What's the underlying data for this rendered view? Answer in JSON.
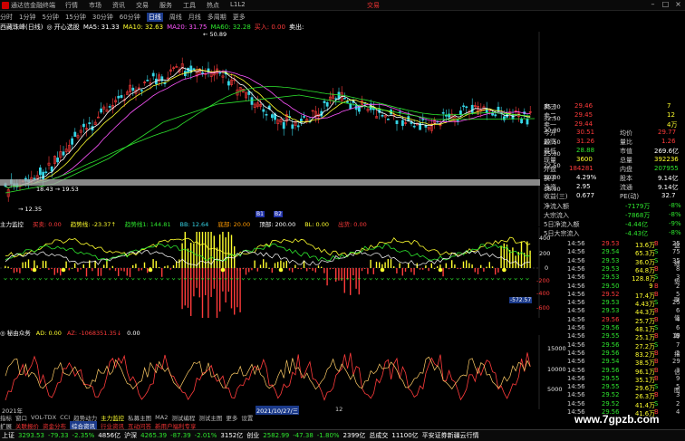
{
  "app_title": "通达信金融终端",
  "menu": [
    "行情",
    "市场",
    "资讯",
    "交易",
    "服务",
    "工具",
    "热点",
    "L1L2"
  ],
  "deal_label": "交易",
  "window_controls": [
    "–",
    "□",
    "×"
  ],
  "toolbar": [
    "分时",
    "1分钟",
    "5分钟",
    "15分钟",
    "30分钟",
    "60分钟",
    "日线",
    "周线",
    "月线",
    "多周期",
    "更多"
  ],
  "toolbar_active": 6,
  "chart_title": [
    {
      "text": "西藏珠峰(日线)",
      "color": "#ffffff"
    },
    {
      "text": "◎ 开心选股",
      "color": "#ffffff"
    },
    {
      "text": "MA5: 31.33",
      "color": "#ffffff"
    },
    {
      "text": "MA10: 32.63",
      "color": "#ffff2e"
    },
    {
      "text": "MA20: 31.75",
      "color": "#ff55ff"
    },
    {
      "text": "MA60: 32.28",
      "color": "#2ee62e"
    },
    {
      "text": "买入: 0.00",
      "color": "#ff3b3b"
    },
    {
      "text": "卖出:",
      "color": "#ffffff"
    }
  ],
  "price_axis": [
    "35.00",
    "32.50",
    "30.00",
    "27.50",
    "25.00",
    "22.50",
    "20.00",
    "18.00"
  ],
  "price_labels": {
    "high": "← 50.89",
    "low": "18.43 → 19.53",
    "low2": "→ 12.35"
  },
  "main_indicator_title": [
    {
      "text": "主力监控",
      "color": "#ffffff"
    },
    {
      "text": "买卖: 0.00",
      "color": "#ff3b3b"
    },
    {
      "text": "趋势线: -23.37↑",
      "color": "#ffff2e"
    },
    {
      "text": "趋势线1: 144.81",
      "color": "#2ee62e"
    },
    {
      "text": "BB: 12.64",
      "color": "#36d6e7"
    },
    {
      "text": "底部: 20.00",
      "color": "#ff9a00"
    },
    {
      "text": "顶部: 200.00",
      "color": "#ffffff"
    },
    {
      "text": "BL: 0.00",
      "color": "#ffff2e"
    },
    {
      "text": "出货: 0.00",
      "color": "#ff3b3b"
    }
  ],
  "ind_axis": [
    "400",
    "200",
    "0",
    "-200",
    "-400",
    "-600"
  ],
  "ind_marker": "-572.57",
  "ind_badges": [
    "B1",
    "B2"
  ],
  "ad_title": [
    {
      "text": "◎ 秘由众务",
      "color": "#ffffff"
    },
    {
      "text": "AD: 0.00",
      "color": "#ffff2e"
    },
    {
      "text": "AZ: -1068351.35↓",
      "color": "#ff3b3b"
    },
    {
      "text": "0.00",
      "color": "#ffffff"
    }
  ],
  "ad_axis": [
    "15000",
    "10000",
    "5000"
  ],
  "date_axis": {
    "year": "2021年",
    "highlight": "2021/10/27/三",
    "month": "12"
  },
  "right_panel": {
    "orderbook": [
      {
        "label": "卖三",
        "price": "29.46",
        "vol": "7"
      },
      {
        "label": "卖二",
        "price": "29.45",
        "vol": "12"
      },
      {
        "label": "卖一",
        "price": "29.44",
        "vol": "4万"
      }
    ],
    "stats": [
      {
        "l1": "今开",
        "v1": "30.51",
        "c1": "#ff3b3b",
        "l2": "均价",
        "v2": "29.77",
        "c2": "#ff3b3b"
      },
      {
        "l1": "最高",
        "v1": "31.26",
        "c1": "#ff3b3b",
        "l2": "量比",
        "v2": "1.26",
        "c2": "#ff3b3b"
      },
      {
        "l1": "最低",
        "v1": "28.88",
        "c1": "#2ee62e",
        "l2": "市值",
        "v2": "269.6亿",
        "c2": "#ffffff"
      },
      {
        "l1": "现量",
        "v1": "3600",
        "c1": "#ffff2e",
        "l2": "总量",
        "v2": "392236",
        "c2": "#ffff2e"
      },
      {
        "l1": "外盘",
        "v1": "184281",
        "c1": "#ff3b3b",
        "l2": "内盘",
        "v2": "207955",
        "c2": "#2ee62e"
      },
      {
        "l1": "换手",
        "v1": "4.29%",
        "c1": "#ffffff",
        "l2": "股本",
        "v2": "9.14亿",
        "c2": "#ffffff"
      },
      {
        "l1": "净资",
        "v1": "2.95",
        "c1": "#ffffff",
        "l2": "流通",
        "v2": "9.14亿",
        "c2": "#ffffff"
      },
      {
        "l1": "收益(三)",
        "v1": "0.677",
        "c1": "#ffffff",
        "l2": "PE(动)",
        "v2": "32.7",
        "c2": "#ffffff"
      }
    ],
    "flows": [
      {
        "label": "净流入额",
        "value": "-7179万",
        "pct": "-8%"
      },
      {
        "label": "大宗流入",
        "value": "-7868万",
        "pct": "-8%"
      },
      {
        "label": "5日净流入额",
        "value": "-4.44亿",
        "pct": "-9%"
      },
      {
        "label": "5日大宗流入",
        "value": "-4.43亿",
        "pct": "-8%"
      }
    ],
    "ticks": [
      {
        "t": "14:56",
        "p": "29.53",
        "v": "13.6万",
        "s": "B",
        "n": "25",
        "pc": "#ff3b3b",
        "sc": "#ff3b3b"
      },
      {
        "t": "14:56",
        "p": "29.54",
        "v": "65.3万",
        "s": "S",
        "n": "75",
        "pc": "#2ee62e",
        "sc": "#2ee62e"
      },
      {
        "t": "14:56",
        "p": "29.53",
        "v": "36.0万",
        "s": "S",
        "n": "35",
        "pc": "#2ee62e",
        "sc": "#2ee62e"
      },
      {
        "t": "14:56",
        "p": "29.53",
        "v": "64.8万",
        "s": "B",
        "n": "8",
        "pc": "#2ee62e",
        "sc": "#ff3b3b"
      },
      {
        "t": "14:56",
        "p": "29.53",
        "v": "128.8万",
        "s": "S",
        "n": "3",
        "pc": "#2ee62e",
        "sc": "#2ee62e"
      },
      {
        "t": "14:56",
        "p": "29.50",
        "v": "9",
        "s": "B",
        "n": "2",
        "pc": "#2ee62e",
        "sc": "#ff3b3b"
      },
      {
        "t": "14:56",
        "p": "29.52",
        "v": "17.4万",
        "s": "B",
        "n": "5",
        "pc": "#ff3b3b",
        "sc": "#ff3b3b"
      },
      {
        "t": "14:56",
        "p": "29.53",
        "v": "4.43万",
        "s": "S",
        "n": "25",
        "pc": "#2ee62e",
        "sc": "#2ee62e"
      },
      {
        "t": "14:56",
        "p": "29.53",
        "v": "44.3万",
        "s": "B",
        "n": "6",
        "pc": "#2ee62e",
        "sc": "#ff3b3b"
      },
      {
        "t": "14:56",
        "p": "29.56",
        "v": "25.7万",
        "s": "B",
        "n": "4",
        "pc": "#ff3b3b",
        "sc": "#ff3b3b"
      },
      {
        "t": "14:56",
        "p": "29.56",
        "v": "48.1万",
        "s": "S",
        "n": "6",
        "pc": "#2ee62e",
        "sc": "#2ee62e"
      },
      {
        "t": "14:56",
        "p": "29.55",
        "v": "25.1万",
        "s": "B",
        "n": "19",
        "pc": "#2ee62e",
        "sc": "#ff3b3b"
      },
      {
        "t": "14:56",
        "p": "29.56",
        "v": "27.2万",
        "s": "S",
        "n": "7",
        "pc": "#2ee62e",
        "sc": "#2ee62e"
      },
      {
        "t": "14:56",
        "p": "29.56",
        "v": "83.2万",
        "s": "B",
        "n": "2",
        "pc": "#2ee62e",
        "sc": "#ff3b3b"
      },
      {
        "t": "14:56",
        "p": "29.54",
        "v": "38.5万",
        "s": "B",
        "n": "29",
        "pc": "#2ee62e",
        "sc": "#ff3b3b"
      },
      {
        "t": "14:56",
        "p": "29.56",
        "v": "96.1万",
        "s": "B",
        "n": "3",
        "pc": "#2ee62e",
        "sc": "#ff3b3b"
      },
      {
        "t": "14:56",
        "p": "29.55",
        "v": "35.1万",
        "s": "B",
        "n": "9",
        "pc": "#2ee62e",
        "sc": "#ff3b3b"
      },
      {
        "t": "14:56",
        "p": "29.55",
        "v": "29.6万",
        "s": "S",
        "n": "5",
        "pc": "#2ee62e",
        "sc": "#2ee62e"
      },
      {
        "t": "14:56",
        "p": "29.52",
        "v": "26.3万",
        "s": "B",
        "n": "3",
        "pc": "#2ee62e",
        "sc": "#ff3b3b"
      },
      {
        "t": "14:56",
        "p": "29.52",
        "v": "41.4万",
        "s": "S",
        "n": "2",
        "pc": "#2ee62e",
        "sc": "#2ee62e"
      },
      {
        "t": "14:56",
        "p": "29.56",
        "v": "41.6万",
        "s": "B",
        "n": "4",
        "pc": "#2ee62e",
        "sc": "#ff3b3b"
      }
    ],
    "side_tabs": [
      "盘",
      "细",
      "势",
      "联",
      "值",
      "筹",
      "指",
      "信",
      "图"
    ]
  },
  "tabs1": [
    "指标",
    "窗口",
    "VOL-TDX",
    "CCI",
    "趋势动力",
    "主力监控",
    "私募主图",
    "MA2",
    "测试编程",
    "测试主图",
    "更多",
    "设置"
  ],
  "tabs2": [
    "扩展",
    "关联报价",
    "资金分布",
    "综合资讯",
    "行业资讯",
    "互动问答",
    "新用户福利专享"
  ],
  "status": [
    {
      "text": "上证",
      "color": "#ffffff"
    },
    {
      "text": "3293.53",
      "color": "#2ee62e"
    },
    {
      "text": "-79.33",
      "color": "#2ee62e"
    },
    {
      "text": "-2.35%",
      "color": "#2ee62e"
    },
    {
      "text": "4856亿",
      "color": "#ffffff"
    },
    {
      "text": "沪深",
      "color": "#ffffff"
    },
    {
      "text": "4265.39",
      "color": "#2ee62e"
    },
    {
      "text": "-87.39",
      "color": "#2ee62e"
    },
    {
      "text": "-2.01%",
      "color": "#2ee62e"
    },
    {
      "text": "3152亿",
      "color": "#ffffff"
    },
    {
      "text": "创业",
      "color": "#ffffff"
    },
    {
      "text": "2582.99",
      "color": "#2ee62e"
    },
    {
      "text": "-47.38",
      "color": "#2ee62e"
    },
    {
      "text": "-1.80%",
      "color": "#2ee62e"
    },
    {
      "text": "2399亿",
      "color": "#ffffff"
    },
    {
      "text": "总成交",
      "color": "#ffffff"
    },
    {
      "text": "11100亿",
      "color": "#ffffff"
    },
    {
      "text": "平安证券新疆云行情",
      "color": "#ffffff"
    }
  ],
  "watermark": "www.7gpzb.com",
  "colors": {
    "up": "#ff3b3b",
    "down": "#2ee62e",
    "ma5": "#ffffff",
    "ma10": "#ffff2e",
    "ma20": "#ff55ff",
    "ma60": "#2ee62e"
  }
}
